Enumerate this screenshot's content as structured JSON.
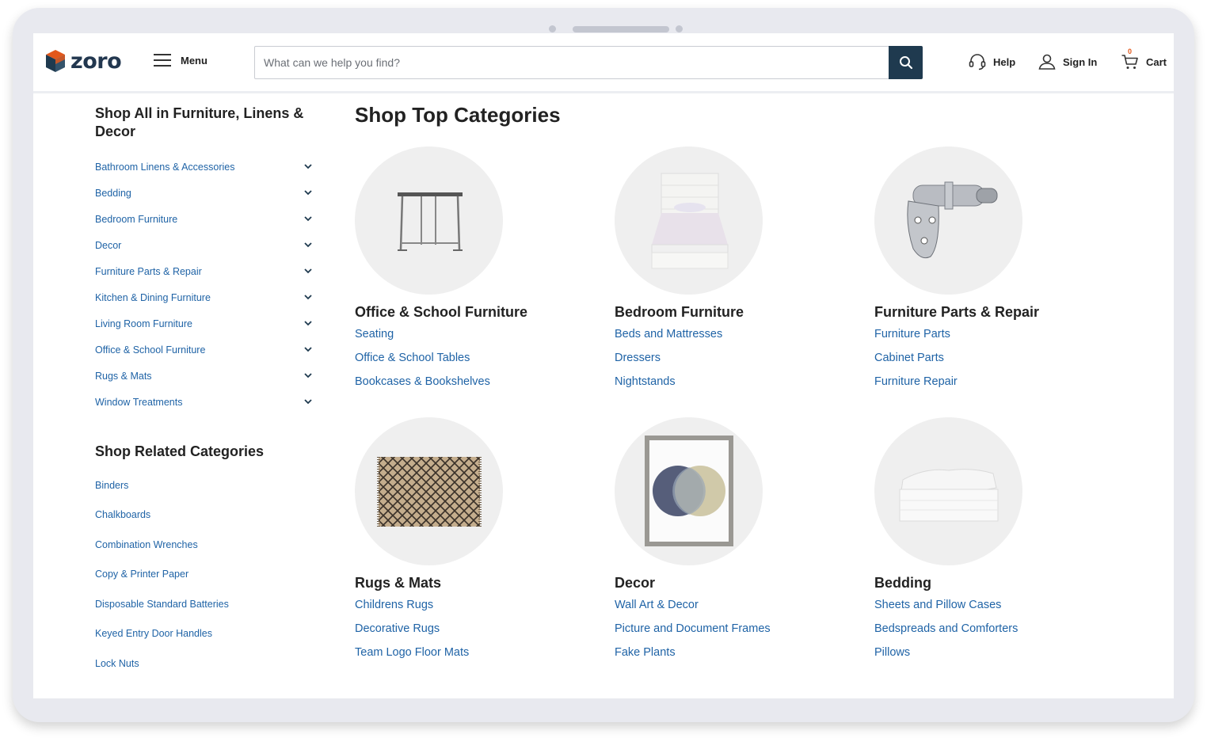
{
  "header": {
    "logo_text": "zoro",
    "menu_label": "Menu",
    "search_placeholder": "What can we help you find?",
    "help_label": "Help",
    "signin_label": "Sign In",
    "cart_label": "Cart",
    "cart_count": "0"
  },
  "sidebar": {
    "title": "Shop All in Furniture, Linens & Decor",
    "items": [
      "Bathroom Linens & Accessories",
      "Bedding",
      "Bedroom Furniture",
      "Decor",
      "Furniture Parts & Repair",
      "Kitchen & Dining Furniture",
      "Living Room Furniture",
      "Office & School Furniture",
      "Rugs & Mats",
      "Window Treatments"
    ],
    "related_title": "Shop Related Categories",
    "related": [
      "Binders",
      "Chalkboards",
      "Combination Wrenches",
      "Copy & Printer Paper",
      "Disposable Standard Batteries",
      "Keyed Entry Door Handles",
      "Lock Nuts"
    ]
  },
  "main": {
    "title": "Shop Top Categories",
    "categories": [
      {
        "name": "Office & School Furniture",
        "links": [
          "Seating",
          "Office & School Tables",
          "Bookcases & Bookshelves"
        ]
      },
      {
        "name": "Bedroom Furniture",
        "links": [
          "Beds and Mattresses",
          "Dressers",
          "Nightstands"
        ]
      },
      {
        "name": "Furniture Parts & Repair",
        "links": [
          "Furniture Parts",
          "Cabinet Parts",
          "Furniture Repair"
        ]
      },
      {
        "name": "Rugs & Mats",
        "links": [
          "Childrens Rugs",
          "Decorative Rugs",
          "Team Logo Floor Mats"
        ]
      },
      {
        "name": "Decor",
        "links": [
          "Wall Art & Decor",
          "Picture and Document Frames",
          "Fake Plants"
        ]
      },
      {
        "name": "Bedding",
        "links": [
          "Sheets and Pillow Cases",
          "Bedspreads and Comforters",
          "Pillows"
        ]
      }
    ]
  },
  "colors": {
    "link": "#1f63a6",
    "brand_navy": "#1f3a4f",
    "brand_orange": "#e2581c"
  }
}
